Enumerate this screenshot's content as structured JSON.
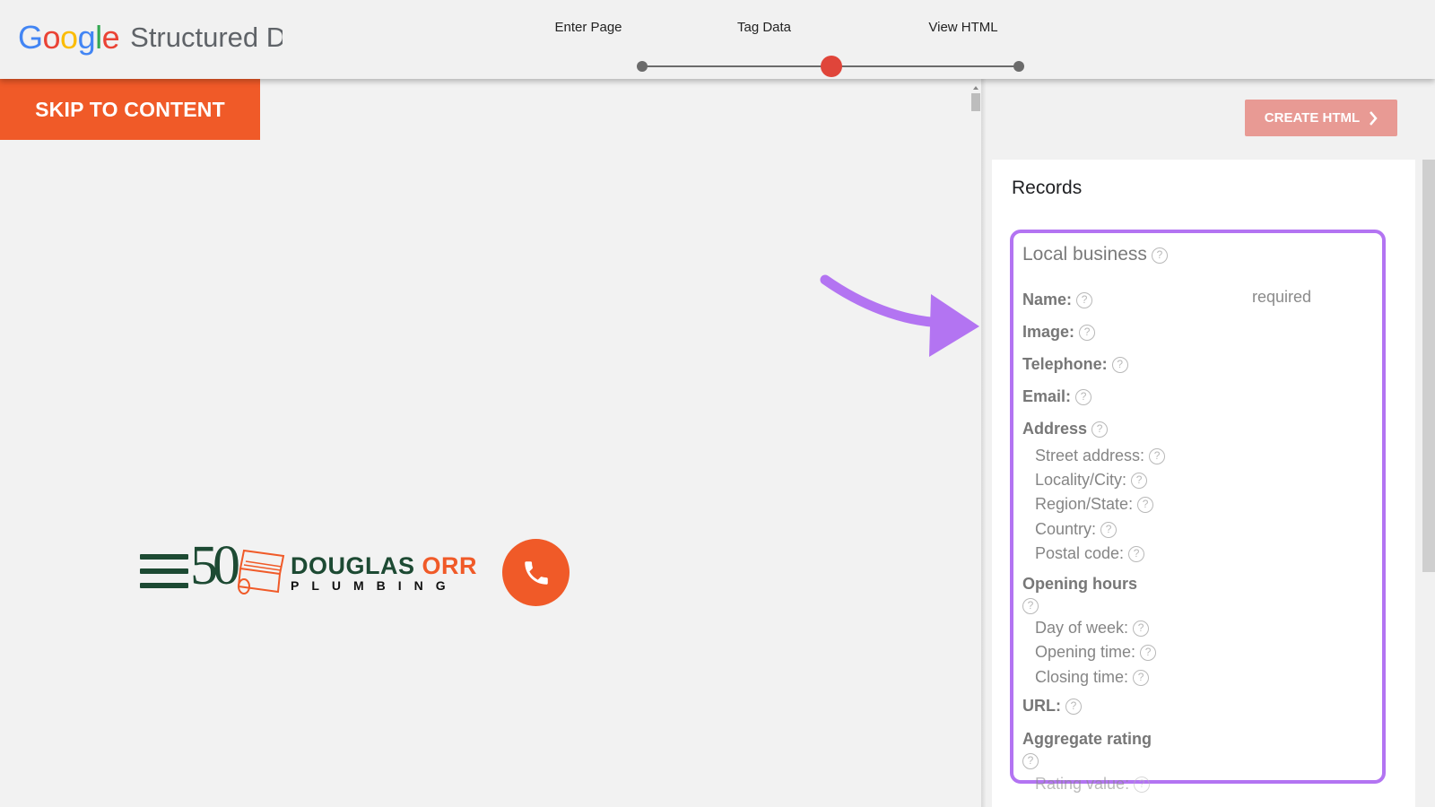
{
  "header": {
    "logo_text": "Google",
    "product_title": "Structured D",
    "steps": [
      "Enter Page",
      "Tag Data",
      "View HTML"
    ],
    "active_step": 2
  },
  "preview": {
    "skip_label": "SKIP TO CONTENT",
    "logo": {
      "number": "50",
      "name_first": "DOUGLAS",
      "name_second": "ORR",
      "subtitle": "PLUMBING"
    },
    "call_icon": "phone-icon"
  },
  "panel": {
    "create_label": "CREATE HTML",
    "records_title": "Records",
    "section": {
      "title": "Local business",
      "required_text": "required",
      "fields": {
        "name": "Name:",
        "image": "Image:",
        "telephone": "Telephone:",
        "email": "Email:",
        "address": "Address",
        "street_address": "Street address:",
        "locality": "Locality/City:",
        "region": "Region/State:",
        "country": "Country:",
        "postal_code": "Postal code:",
        "opening_hours": "Opening hours",
        "day_of_week": "Day of week:",
        "opening_time": "Opening time:",
        "closing_time": "Closing time:",
        "url": "URL:",
        "aggregate_rating": "Aggregate rating",
        "rating_value": "Rating value:"
      }
    }
  },
  "colors": {
    "accent_orange": "#f05a28",
    "step_active": "#e0453a",
    "highlight_purple": "#b374f2",
    "logo_green": "#1d4a33"
  }
}
